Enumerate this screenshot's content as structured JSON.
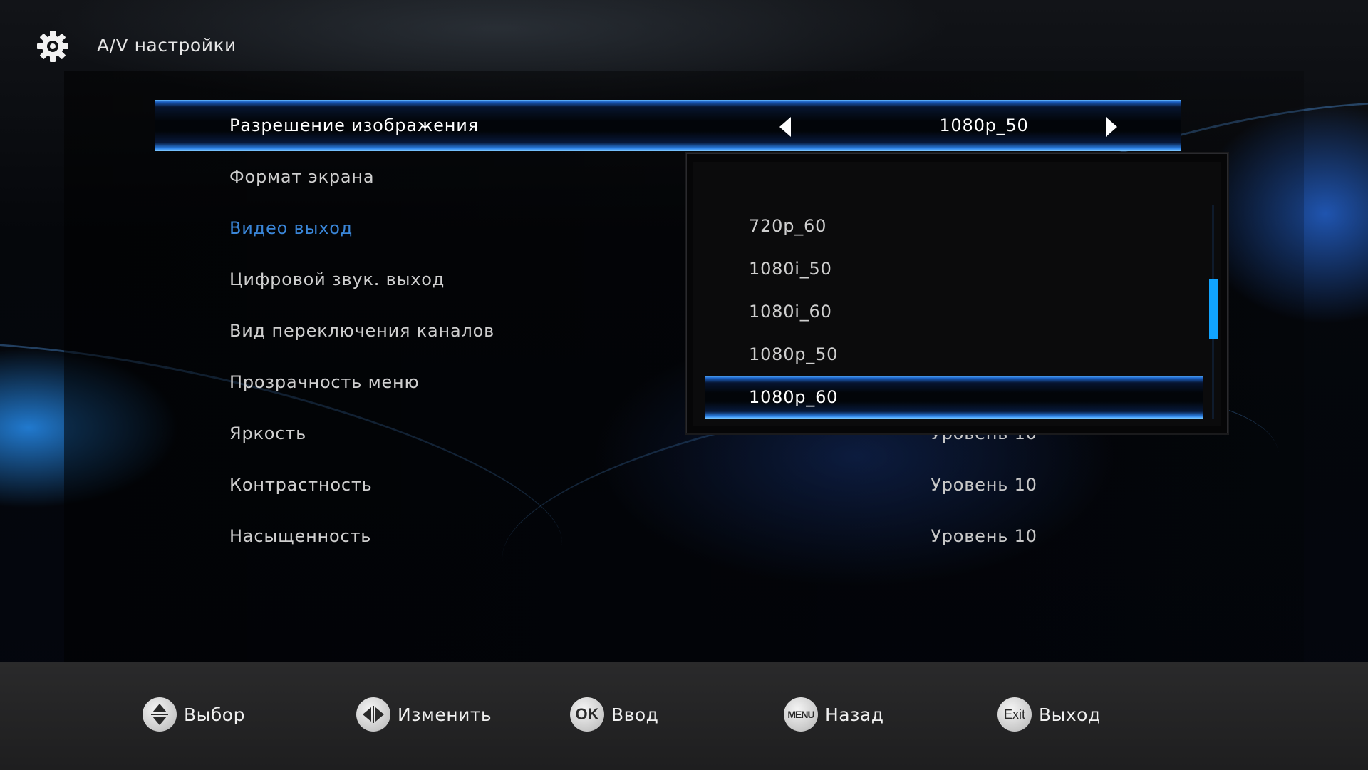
{
  "header": {
    "title": "A/V настройки",
    "icon": "gear-icon"
  },
  "menu": {
    "items": [
      {
        "label": "Разрешение изображения",
        "value": "1080p_50",
        "selected": true
      },
      {
        "label": "Формат экрана",
        "value": ""
      },
      {
        "label": "Видео выход",
        "value": ""
      },
      {
        "label": "Цифровой звук. выход",
        "value": ""
      },
      {
        "label": "Вид переключения каналов",
        "value": ""
      },
      {
        "label": "Прозрачность меню",
        "value": ""
      },
      {
        "label": "Яркость",
        "value": "Уровень 10"
      },
      {
        "label": "Контрастность",
        "value": "Уровень 10"
      },
      {
        "label": "Насыщенность",
        "value": "Уровень 10"
      }
    ]
  },
  "dropdown": {
    "options": [
      "720p_60",
      "1080i_50",
      "1080i_60",
      "1080p_50",
      "1080p_60"
    ],
    "selected_index": 4
  },
  "footer": {
    "hints": [
      {
        "key": "",
        "key_icon": "up-down-icon",
        "label": "Выбор"
      },
      {
        "key": "",
        "key_icon": "left-right-icon",
        "label": "Изменить"
      },
      {
        "key": "OK",
        "key_icon": "ok-key-icon",
        "label": "Ввод"
      },
      {
        "key": "MENU",
        "key_icon": "menu-key-icon",
        "label": "Назад"
      },
      {
        "key": "Exit",
        "key_icon": "exit-key-icon",
        "label": "Выход"
      }
    ]
  },
  "colors": {
    "accent_text": "#3a86d8",
    "highlight": "#2a80e8",
    "scroll_thumb": "#11a4ff"
  }
}
